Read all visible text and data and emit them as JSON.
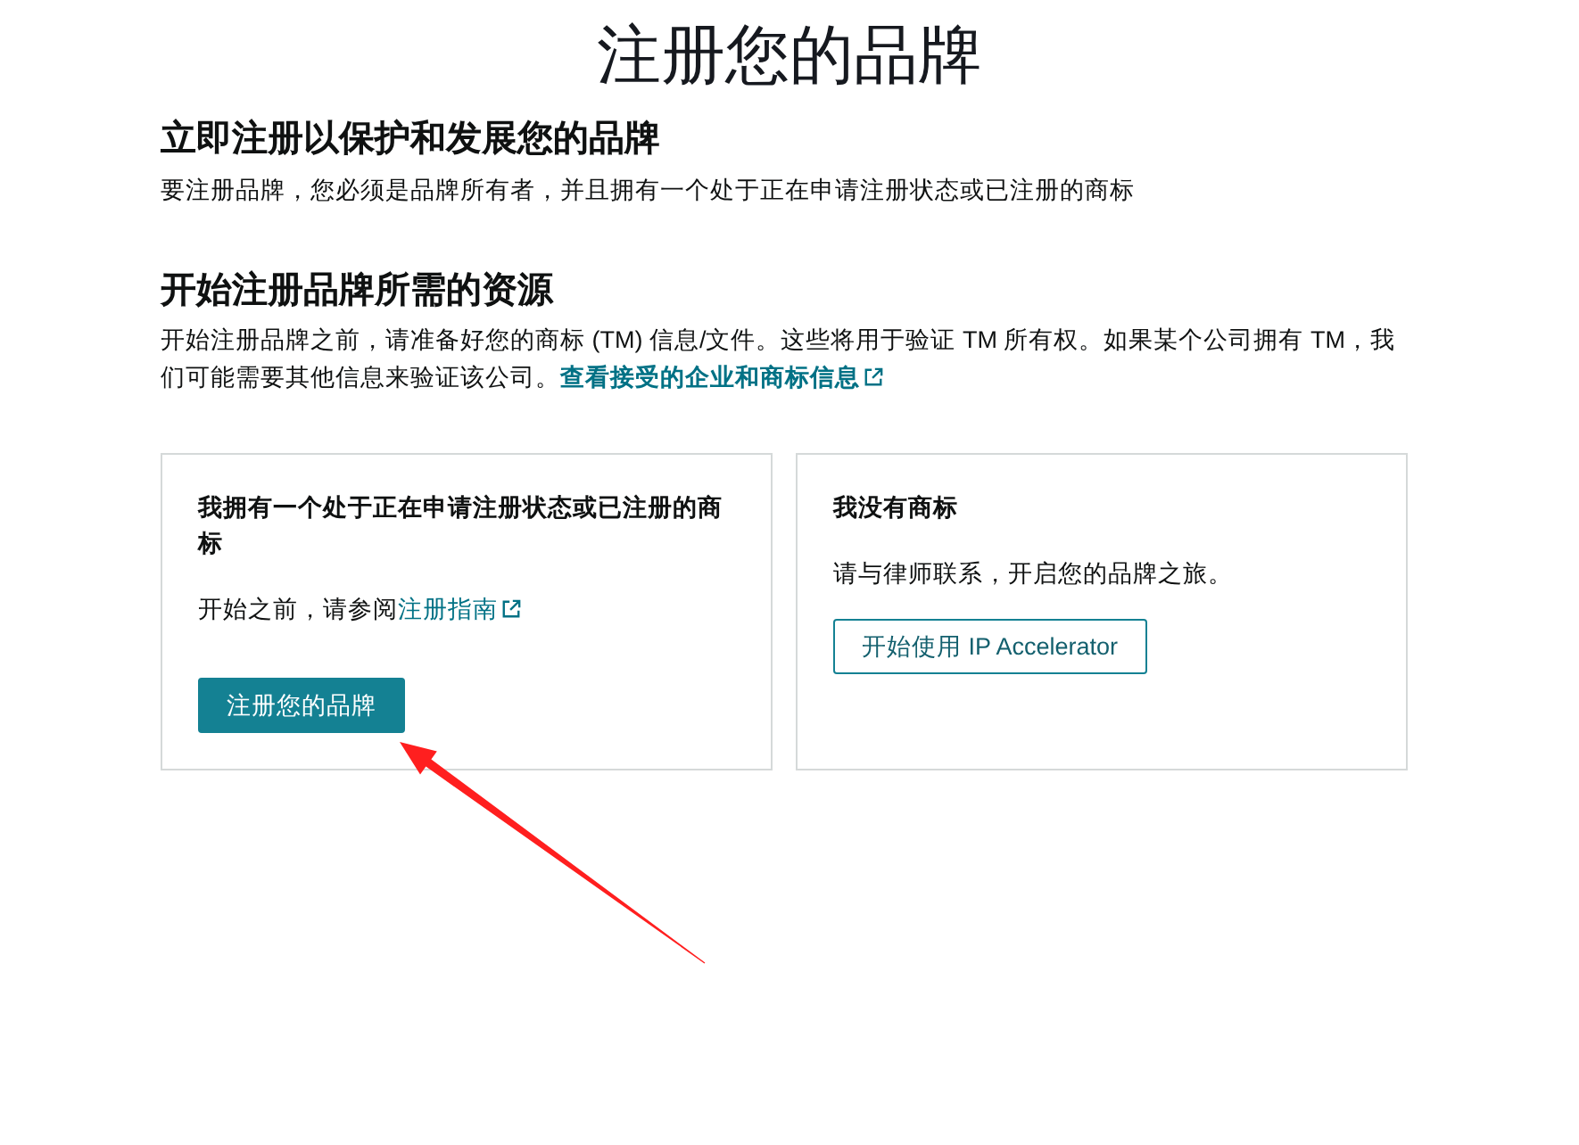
{
  "page": {
    "title": "注册您的品牌"
  },
  "intro": {
    "heading": "立即注册以保护和发展您的品牌",
    "text": "要注册品牌，您必须是品牌所有者，并且拥有一个处于正在申请注册状态或已注册的商标"
  },
  "resources": {
    "heading": "开始注册品牌所需的资源",
    "text": "开始注册品牌之前，请准备好您的商标 (TM) 信息/文件。这些将用于验证 TM 所有权。如果某个公司拥有 TM，我们可能需要其他信息来验证该公司。",
    "link": "查看接受的企业和商标信息"
  },
  "cards": [
    {
      "title": "我拥有一个处于正在申请注册状态或已注册的商标",
      "text": "开始之前，请参阅",
      "link": "注册指南",
      "button": {
        "label": "注册您的品牌",
        "kind": "primary"
      }
    },
    {
      "title": "我没有商标",
      "text": "请与律师联系，开启您的品牌之旅。",
      "button": {
        "label": "开始使用 IP Accelerator",
        "kind": "secondary"
      }
    }
  ],
  "annotation": {
    "kind": "arrow"
  }
}
